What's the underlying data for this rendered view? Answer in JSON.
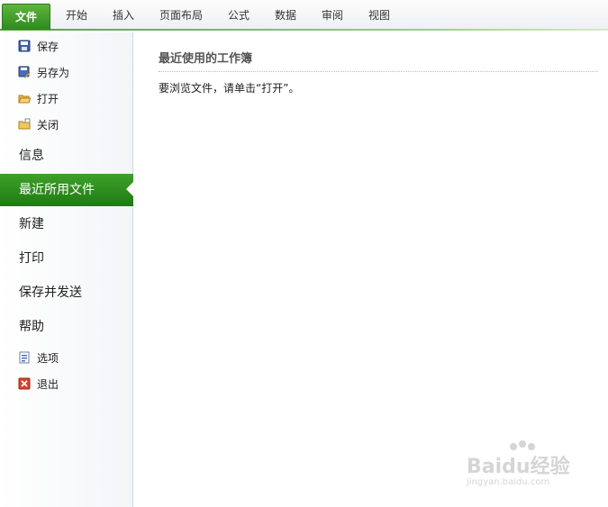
{
  "ribbon": {
    "tabs": [
      {
        "label": "文件"
      },
      {
        "label": "开始"
      },
      {
        "label": "插入"
      },
      {
        "label": "页面布局"
      },
      {
        "label": "公式"
      },
      {
        "label": "数据"
      },
      {
        "label": "审阅"
      },
      {
        "label": "视图"
      }
    ]
  },
  "sidebar": {
    "commands": [
      {
        "label": "保存",
        "icon": "save-icon"
      },
      {
        "label": "另存为",
        "icon": "save-as-icon"
      },
      {
        "label": "打开",
        "icon": "open-folder-icon"
      },
      {
        "label": "关闭",
        "icon": "close-folder-icon"
      }
    ],
    "categories": [
      {
        "label": "信息"
      },
      {
        "label": "最近所用文件",
        "selected": true
      },
      {
        "label": "新建"
      },
      {
        "label": "打印"
      },
      {
        "label": "保存并发送"
      },
      {
        "label": "帮助"
      }
    ],
    "bottom_commands": [
      {
        "label": "选项",
        "icon": "options-icon"
      },
      {
        "label": "退出",
        "icon": "exit-icon"
      }
    ]
  },
  "main": {
    "section_title": "最近使用的工作簿",
    "hint": "要浏览文件，请单击“打开”。"
  },
  "watermark": {
    "brand": "Baidu经验",
    "url": "jingyan.baidu.com"
  },
  "colors": {
    "accent_green": "#2e8a1f",
    "selected_green": "#1f7a14"
  }
}
